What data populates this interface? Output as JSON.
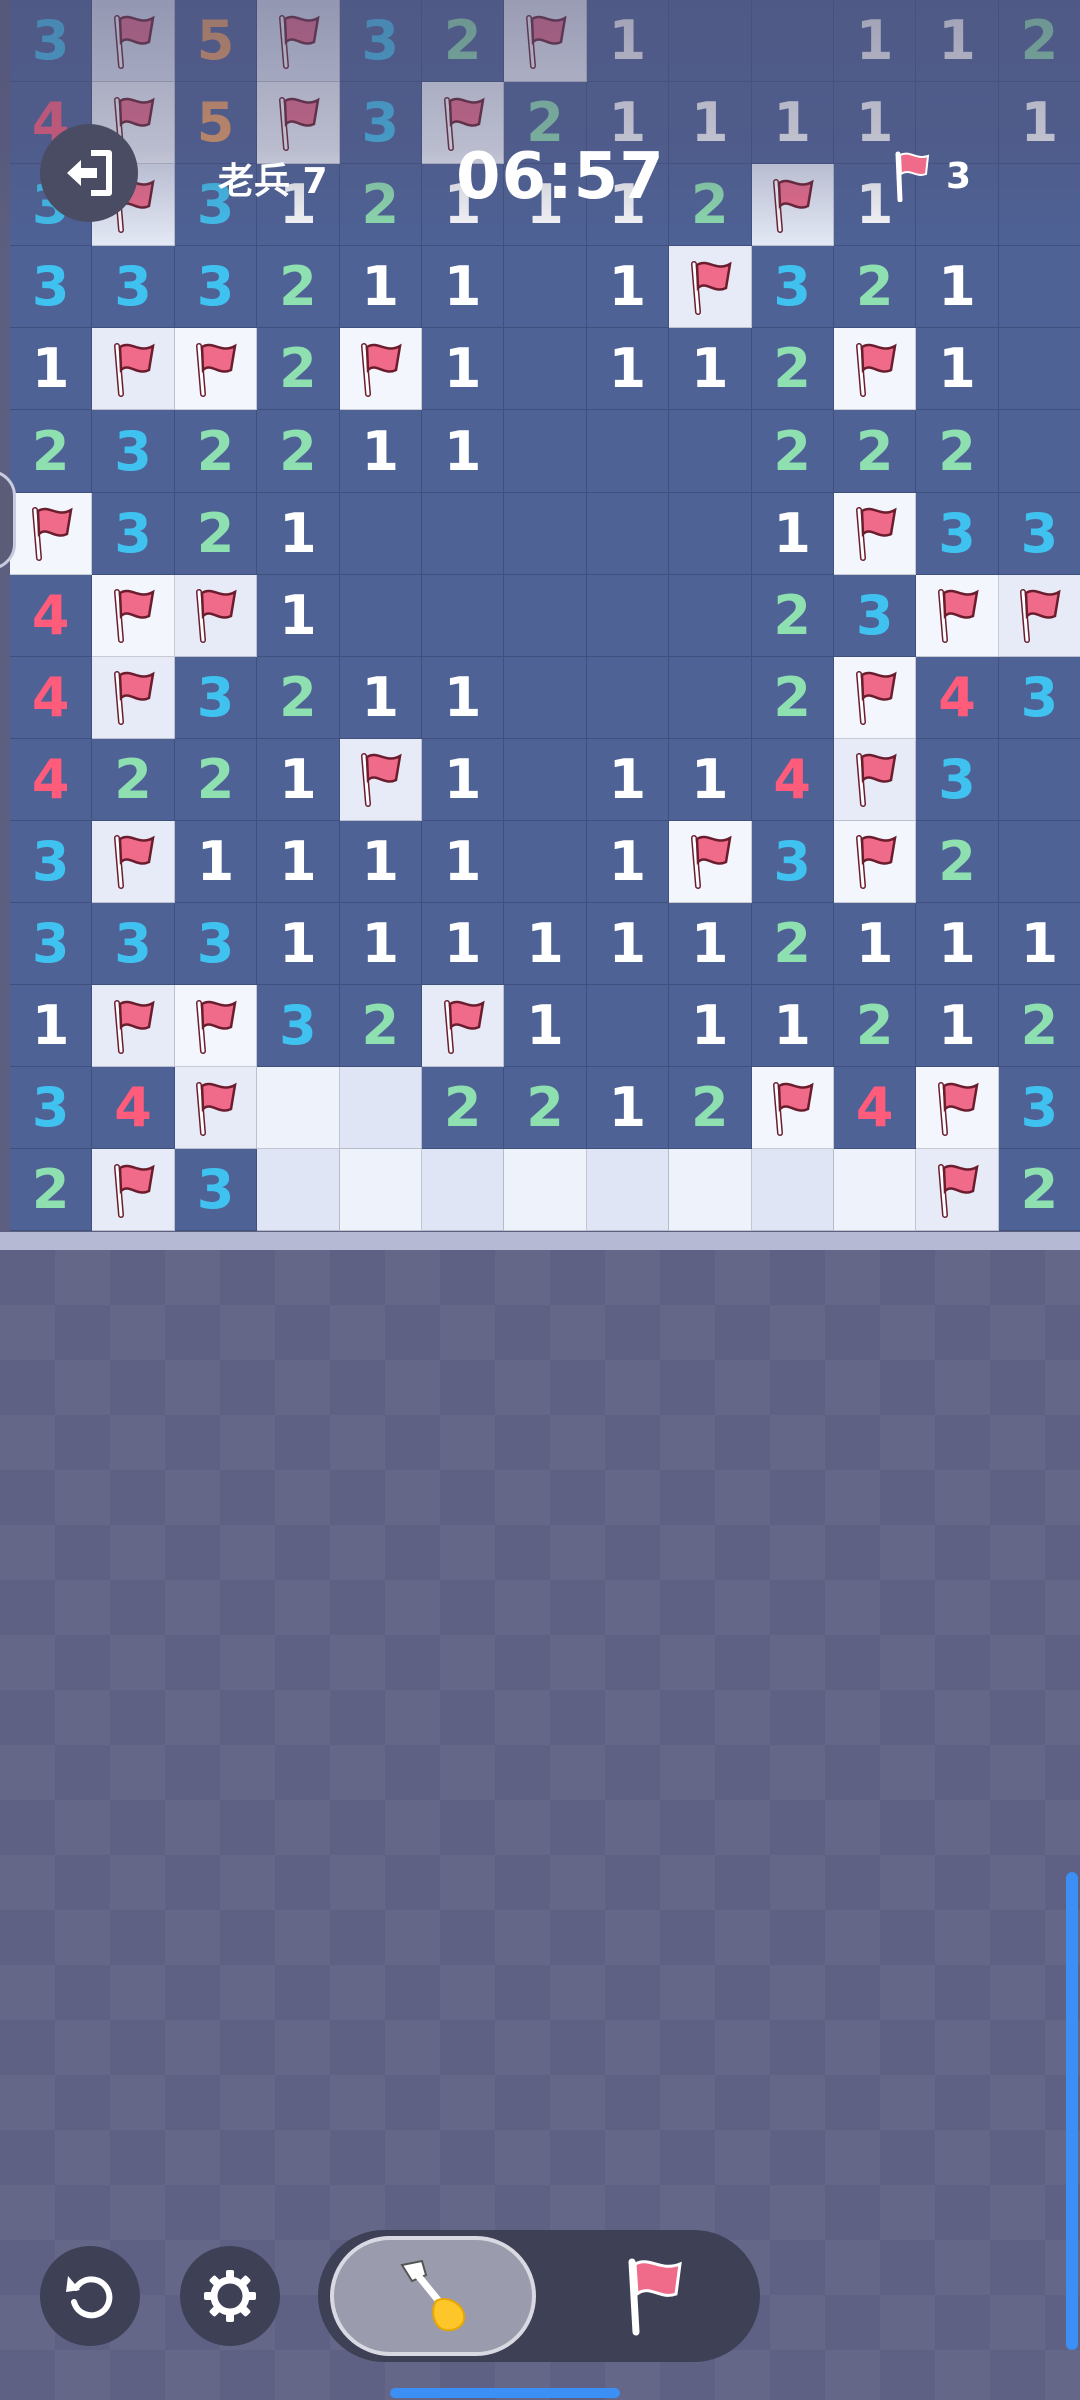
{
  "hud": {
    "level_label": "老兵 7",
    "timer": "06:57",
    "flags_remaining": "3"
  },
  "colors": {
    "revealed": "#4e6296",
    "hidden": "#dfe5f4",
    "number_1": "#ffffff",
    "number_2": "#8fe0b0",
    "number_3": "#40c2f0",
    "number_4": "#ff5c7c",
    "number_5": "#f0a060",
    "flag": "#f06b8a",
    "accent": "#3b8ff5"
  },
  "icons": {
    "exit": "exit-icon",
    "flag": "flag-icon",
    "undo": "undo-icon",
    "settings": "gear-icon",
    "dig": "shovel-icon"
  },
  "board": {
    "columns": 13,
    "rows": 15,
    "cells": [
      [
        "3",
        "F",
        "5",
        "F",
        "3",
        "2",
        "F",
        "1",
        "",
        "",
        "1",
        "1",
        "2"
      ],
      [
        "4",
        "F",
        "5",
        "F",
        "3",
        "F",
        "2",
        "1",
        "1",
        "1",
        "1",
        "",
        "1"
      ],
      [
        "3",
        "F",
        "3",
        "1",
        "2",
        "1",
        "1",
        "1",
        "2",
        "F",
        "1",
        "",
        ""
      ],
      [
        "3",
        "3",
        "3",
        "2",
        "1",
        "1",
        "",
        "1",
        "F",
        "3",
        "2",
        "1",
        ""
      ],
      [
        "1",
        "F",
        "F",
        "2",
        "F",
        "1",
        "",
        "1",
        "1",
        "2",
        "F",
        "1",
        ""
      ],
      [
        "2",
        "3",
        "2",
        "2",
        "1",
        "1",
        "",
        "",
        "",
        "2",
        "2",
        "2",
        ""
      ],
      [
        "F",
        "3",
        "2",
        "1",
        "",
        "",
        "",
        "",
        "",
        "1",
        "F",
        "3",
        "3"
      ],
      [
        "4",
        "F",
        "F",
        "1",
        "",
        "",
        "",
        "",
        "",
        "2",
        "3",
        "F",
        "F"
      ],
      [
        "4",
        "F",
        "3",
        "2",
        "1",
        "1",
        "",
        "",
        "",
        "2",
        "F",
        "4",
        "3"
      ],
      [
        "4",
        "2",
        "2",
        "1",
        "F",
        "1",
        "",
        "1",
        "1",
        "4",
        "F",
        "3",
        ""
      ],
      [
        "3",
        "F",
        "1",
        "1",
        "1",
        "1",
        "",
        "1",
        "F",
        "3",
        "F",
        "2",
        ""
      ],
      [
        "3",
        "3",
        "3",
        "1",
        "1",
        "1",
        "1",
        "1",
        "1",
        "2",
        "1",
        "1",
        "1"
      ],
      [
        "1",
        "F",
        "F",
        "3",
        "2",
        "F",
        "1",
        "",
        "1",
        "1",
        "2",
        "1",
        "2"
      ],
      [
        "3",
        "4",
        "F",
        "H",
        "H",
        "2",
        "2",
        "1",
        "2",
        "F",
        "4",
        "F",
        "3"
      ],
      [
        "2",
        "F",
        "3",
        "H",
        "H",
        "H",
        "H",
        "H",
        "H",
        "H",
        "H",
        "F",
        "2"
      ]
    ]
  }
}
